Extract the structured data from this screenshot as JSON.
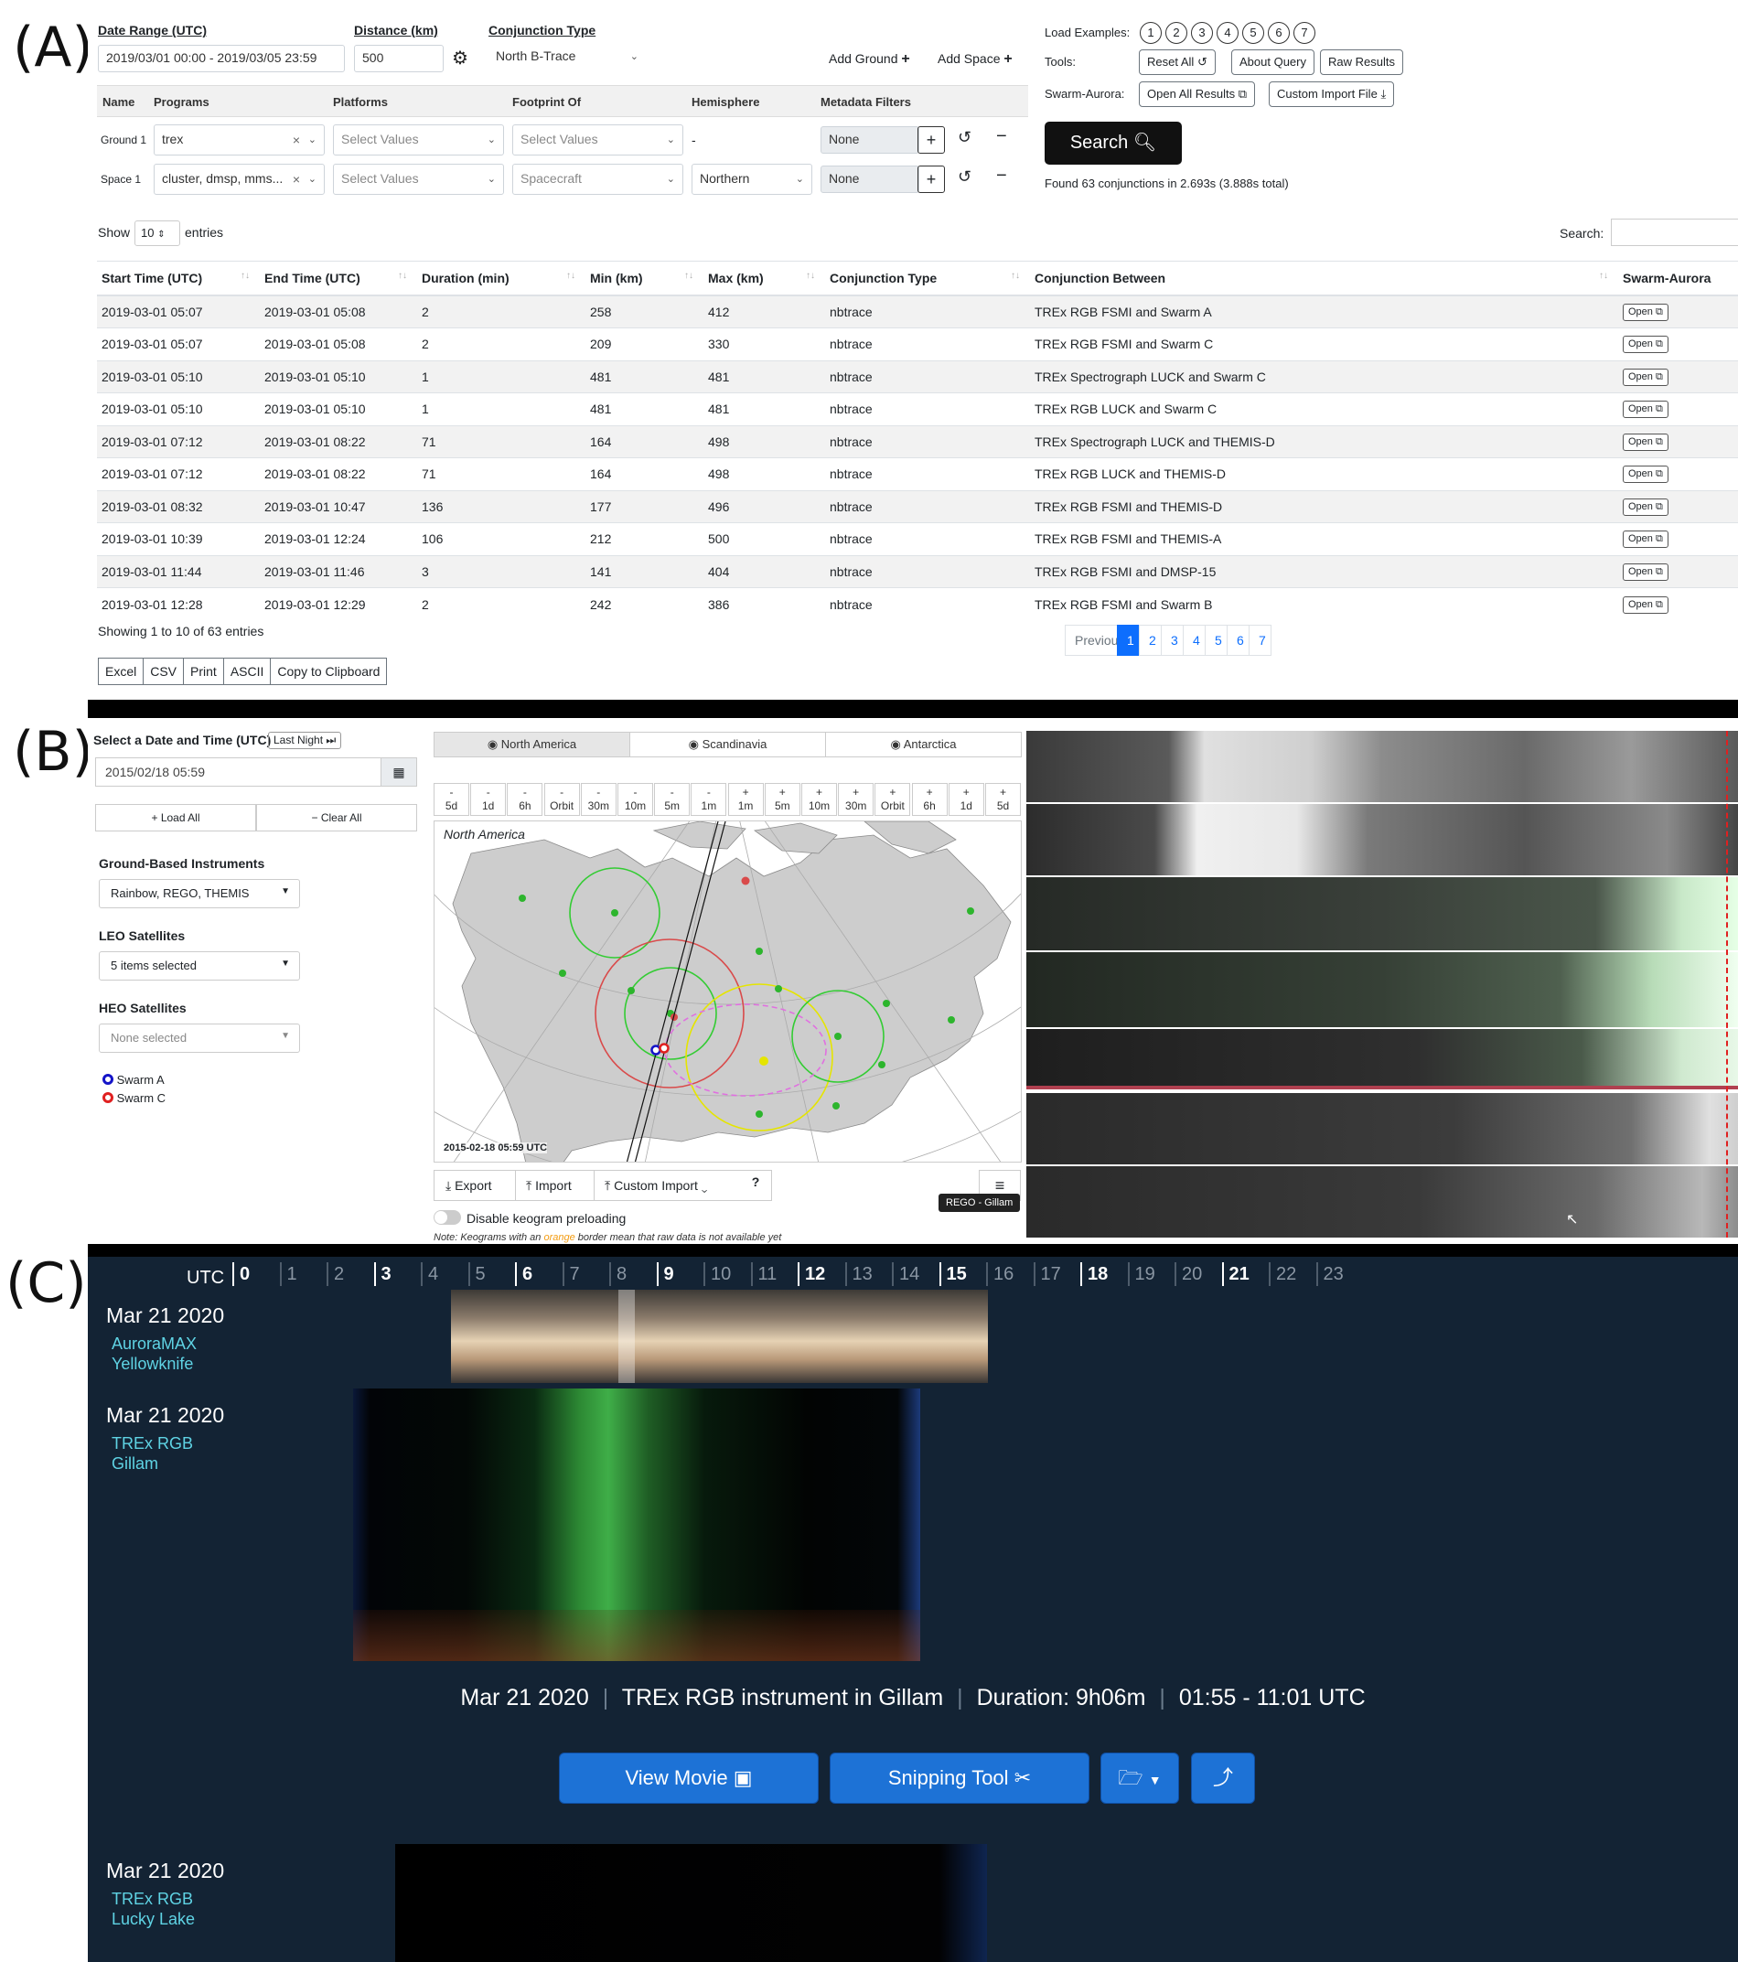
{
  "panel_labels": {
    "a": "(A)",
    "b": "(B)",
    "c": "(C)"
  },
  "panelA": {
    "date_range_label": "Date Range (UTC)",
    "date_range_value": "2019/03/01 00:00 - 2019/03/05 23:59",
    "distance_label": "Distance (km)",
    "distance_value": "500",
    "conjunction_type_label": "Conjunction Type",
    "conjunction_type_value": "North B-Trace",
    "add_ground": "Add Ground",
    "add_space": "Add Space",
    "load_examples_label": "Load Examples:",
    "examples": [
      "1",
      "2",
      "3",
      "4",
      "5",
      "6",
      "7"
    ],
    "tools_label": "Tools:",
    "tools": [
      "Reset All",
      "About Query",
      "Raw Results"
    ],
    "swarm_aurora_label": "Swarm-Aurora:",
    "swarm_aurora_buttons": [
      "Open All Results",
      "Custom Import File"
    ],
    "search_button": "Search",
    "found_text": "Found 63 conjunctions in 2.693s (3.888s total)",
    "query_headers": [
      "Name",
      "Programs",
      "Platforms",
      "Footprint Of",
      "Hemisphere",
      "Metadata Filters"
    ],
    "ground_row": {
      "name": "Ground 1",
      "programs": "trex",
      "platforms": "Select Values",
      "footprint": "Select Values",
      "hemisphere": "-",
      "metadata": "None"
    },
    "space_row": {
      "name": "Space 1",
      "programs": "cluster, dmsp, mms...",
      "platforms": "Select Values",
      "footprint": "Spacecraft",
      "hemisphere": "Northern",
      "metadata": "None"
    },
    "show_label": "Show",
    "show_value": "10",
    "entries_label": "entries",
    "search_label": "Search:",
    "columns": [
      "Start Time (UTC)",
      "End Time (UTC)",
      "Duration (min)",
      "Min (km)",
      "Max (km)",
      "Conjunction Type",
      "Conjunction Between",
      "Swarm-Aurora"
    ],
    "rows": [
      [
        "2019-03-01 05:07",
        "2019-03-01 05:08",
        "2",
        "258",
        "412",
        "nbtrace",
        "TREx RGB FSMI and Swarm A",
        "Open"
      ],
      [
        "2019-03-01 05:07",
        "2019-03-01 05:08",
        "2",
        "209",
        "330",
        "nbtrace",
        "TREx RGB FSMI and Swarm C",
        "Open"
      ],
      [
        "2019-03-01 05:10",
        "2019-03-01 05:10",
        "1",
        "481",
        "481",
        "nbtrace",
        "TREx Spectrograph LUCK and Swarm C",
        "Open"
      ],
      [
        "2019-03-01 05:10",
        "2019-03-01 05:10",
        "1",
        "481",
        "481",
        "nbtrace",
        "TREx RGB LUCK and Swarm C",
        "Open"
      ],
      [
        "2019-03-01 07:12",
        "2019-03-01 08:22",
        "71",
        "164",
        "498",
        "nbtrace",
        "TREx Spectrograph LUCK and THEMIS-D",
        "Open"
      ],
      [
        "2019-03-01 07:12",
        "2019-03-01 08:22",
        "71",
        "164",
        "498",
        "nbtrace",
        "TREx RGB LUCK and THEMIS-D",
        "Open"
      ],
      [
        "2019-03-01 08:32",
        "2019-03-01 10:47",
        "136",
        "177",
        "496",
        "nbtrace",
        "TREx RGB FSMI and THEMIS-D",
        "Open"
      ],
      [
        "2019-03-01 10:39",
        "2019-03-01 12:24",
        "106",
        "212",
        "500",
        "nbtrace",
        "TREx RGB FSMI and THEMIS-A",
        "Open"
      ],
      [
        "2019-03-01 11:44",
        "2019-03-01 11:46",
        "3",
        "141",
        "404",
        "nbtrace",
        "TREx RGB FSMI and DMSP-15",
        "Open"
      ],
      [
        "2019-03-01 12:28",
        "2019-03-01 12:29",
        "2",
        "242",
        "386",
        "nbtrace",
        "TREx RGB FSMI and Swarm B",
        "Open"
      ]
    ],
    "showing_text": "Showing 1 to 10 of 63 entries",
    "pagination": [
      "Previous",
      "1",
      "2",
      "3",
      "4",
      "5",
      "6",
      "7"
    ],
    "export_buttons": [
      "Excel",
      "CSV",
      "Print",
      "ASCII",
      "Copy to Clipboard"
    ]
  },
  "panelB": {
    "date_label": "Select a Date and Time (UTC)",
    "last_night": "Last Night",
    "date_value": "2015/02/18 05:59",
    "load_all": "Load All",
    "clear_all": "Clear All",
    "ground_label": "Ground-Based Instruments",
    "ground_value": "Rainbow, REGO, THEMIS",
    "leo_label": "LEO Satellites",
    "leo_value": "5 items selected",
    "heo_label": "HEO Satellites",
    "heo_value": "None selected",
    "legend": [
      "Swarm A",
      "Swarm C"
    ],
    "region_tabs": [
      "North America",
      "Scandinavia",
      "Antarctica"
    ],
    "time_steps": [
      [
        "-",
        "5d"
      ],
      [
        "-",
        "1d"
      ],
      [
        "-",
        "6h"
      ],
      [
        "-",
        "Orbit"
      ],
      [
        "-",
        "30m"
      ],
      [
        "-",
        "10m"
      ],
      [
        "-",
        "5m"
      ],
      [
        "-",
        "1m"
      ],
      [
        "+",
        "1m"
      ],
      [
        "+",
        "5m"
      ],
      [
        "+",
        "10m"
      ],
      [
        "+",
        "30m"
      ],
      [
        "+",
        "Orbit"
      ],
      [
        "+",
        "6h"
      ],
      [
        "+",
        "1d"
      ],
      [
        "+",
        "5d"
      ]
    ],
    "map_title": "North America",
    "map_timestamp": "2015-02-18 05:59 UTC",
    "export": "Export",
    "import": "Import",
    "custom_import": "Custom Import",
    "disable_preload": "Disable keogram preloading",
    "note_prefix": "Note: Keograms with an ",
    "note_orange": "orange",
    "note_suffix": " border mean that raw data is not available yet",
    "tooltip": "REGO - Gillam"
  },
  "panelC": {
    "utc_label": "UTC",
    "hours": [
      "0",
      "1",
      "2",
      "3",
      "4",
      "5",
      "6",
      "7",
      "8",
      "9",
      "10",
      "11",
      "12",
      "13",
      "14",
      "15",
      "16",
      "17",
      "18",
      "19",
      "20",
      "21",
      "22",
      "23"
    ],
    "rows": [
      {
        "date": "Mar 21 2020",
        "line1": "AuroraMAX",
        "line2": "Yellowknife"
      },
      {
        "date": "Mar 21 2020",
        "line1": "TREx RGB",
        "line2": "Gillam"
      },
      {
        "date": "Mar 21 2020",
        "line1": "TREx RGB",
        "line2": "Lucky Lake"
      }
    ],
    "info": {
      "date": "Mar 21 2020",
      "instrument": "TREx RGB instrument in Gillam",
      "duration": "Duration: 9h06m",
      "time_range": "01:55 - 11:01 UTC",
      "sep": "|"
    },
    "buttons": [
      "View Movie",
      "Snipping Tool"
    ]
  }
}
